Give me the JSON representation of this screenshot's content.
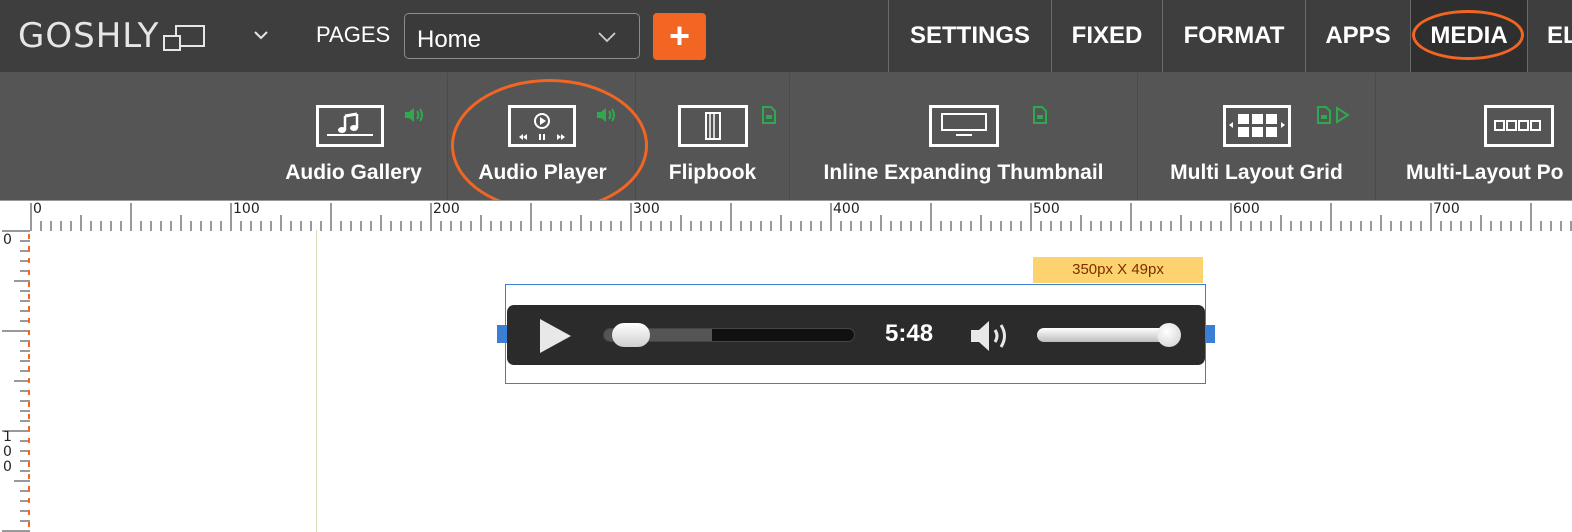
{
  "app": {
    "logo_text": "GOSHLY",
    "pages_label": "PAGES",
    "page_selected": "Home",
    "add_page_label": "+"
  },
  "nav_tabs": [
    {
      "label": "SETTINGS"
    },
    {
      "label": "FIXED"
    },
    {
      "label": "FORMAT"
    },
    {
      "label": "APPS"
    },
    {
      "label": "MEDIA",
      "active": true
    },
    {
      "label": "EL"
    }
  ],
  "widgets": [
    {
      "label": "Audio Gallery",
      "icon": "music-note-icon",
      "badge": "speaker-badge-icon"
    },
    {
      "label": "Audio Player",
      "icon": "audio-player-icon",
      "badge": "speaker-badge-icon"
    },
    {
      "label": "Flipbook",
      "icon": "flipbook-icon",
      "badge": "file-badge-icon"
    },
    {
      "label": "Inline Expanding Thumbnail",
      "icon": "monitor-icon",
      "badge": "file-badge-icon"
    },
    {
      "label": "Multi Layout Grid",
      "icon": "grid-icon",
      "badge": "file-play-badge-icon"
    },
    {
      "label": "Multi-Layout Po",
      "icon": "strip-icon"
    }
  ],
  "ruler": {
    "h_labels": [
      "0",
      "100",
      "200",
      "300",
      "400",
      "500",
      "600",
      "700"
    ],
    "v_labels": [
      "0",
      "1\n0\n0"
    ]
  },
  "canvas": {
    "size_tag": "350px X 49px",
    "player": {
      "time": "5:48",
      "progress_fraction": 0.04,
      "buffered_fraction": 0.43,
      "volume_fraction": 0.95
    }
  },
  "colors": {
    "accent": "#f26522",
    "topbar": "#3e3e3e",
    "toolbar": "#555555",
    "selection": "#3b7fd4",
    "badge_green": "#2fa84f",
    "size_tag": "#fcd36e"
  }
}
